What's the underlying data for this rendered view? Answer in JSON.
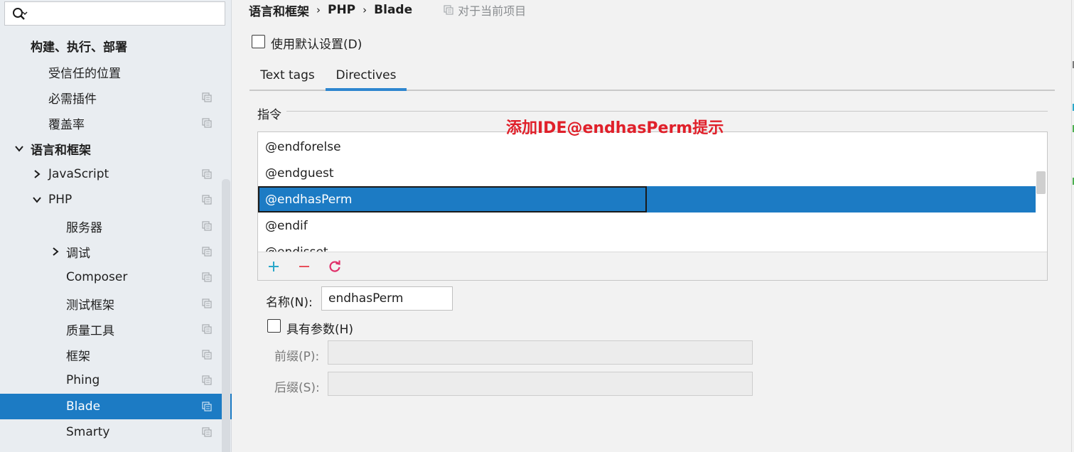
{
  "sidebar": {
    "search": {
      "value": "",
      "placeholder": ""
    },
    "items": [
      {
        "label": "构建、执行、部署"
      },
      {
        "label": "受信任的位置"
      },
      {
        "label": "必需插件"
      },
      {
        "label": "覆盖率"
      },
      {
        "label": "语言和框架"
      },
      {
        "label": "JavaScript"
      },
      {
        "label": "PHP"
      },
      {
        "label": "服务器"
      },
      {
        "label": "调试"
      },
      {
        "label": "Composer"
      },
      {
        "label": "测试框架"
      },
      {
        "label": "质量工具"
      },
      {
        "label": "框架"
      },
      {
        "label": "Phing"
      },
      {
        "label": "Blade"
      },
      {
        "label": "Smarty"
      }
    ]
  },
  "breadcrumb": {
    "parts": [
      "语言和框架",
      "PHP",
      "Blade"
    ],
    "separator": "›",
    "project_scope": "对于当前项目"
  },
  "use_defaults": {
    "label": "使用默认设置(D)",
    "checked": false
  },
  "tabs": [
    {
      "label": "Text tags",
      "active": false
    },
    {
      "label": "Directives",
      "active": true
    }
  ],
  "directives": {
    "group_title": "指令",
    "annotation": "添加IDE@endhasPerm提示",
    "items": [
      "@endforelse",
      "@endguest",
      "@endhasPerm",
      "@endif",
      "@endisset"
    ],
    "selected": "@endhasPerm",
    "toolbar": {
      "add_icon": "plus-icon",
      "remove_icon": "minus-icon",
      "reset_icon": "refresh-icon"
    }
  },
  "name_field": {
    "label": "名称(N):",
    "value": "endhasPerm"
  },
  "has_params": {
    "label": "具有参数(H)",
    "checked": false
  },
  "prefix_field": {
    "label": "前缀(P):",
    "value": ""
  },
  "suffix_field": {
    "label": "后缀(S):",
    "value": ""
  },
  "colors": {
    "selection": "#1c7bc4",
    "sidebar_bg": "#e9edf1",
    "annotation": "#e0202a",
    "add": "#2aa7c9",
    "remove": "#e8505b",
    "reset": "#e0306a"
  }
}
